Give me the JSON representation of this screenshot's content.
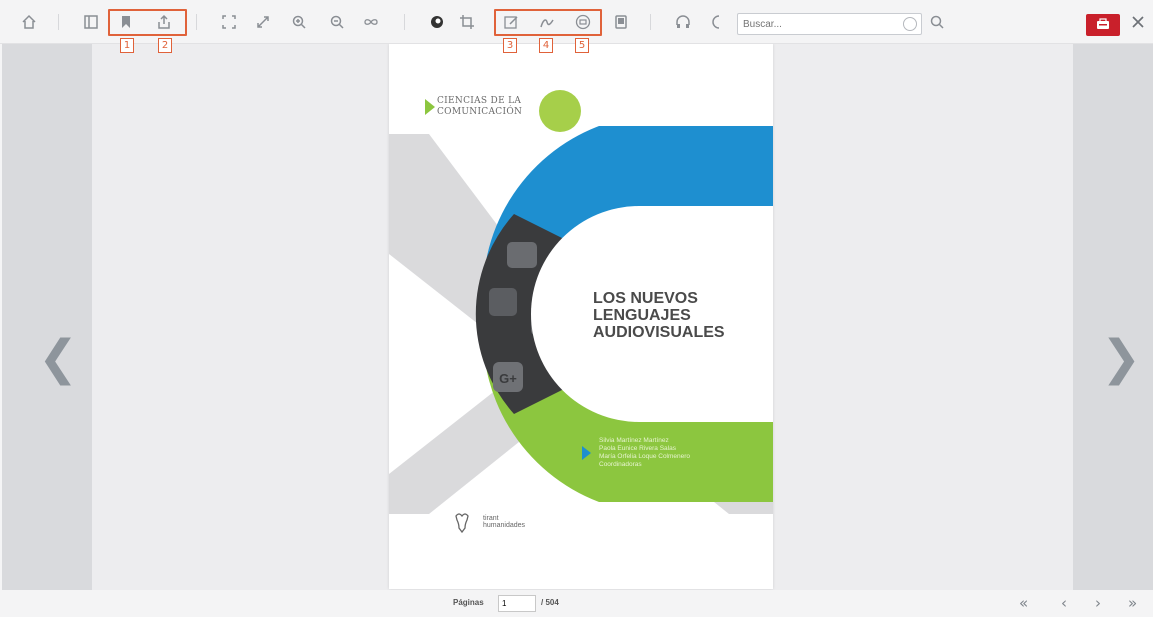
{
  "toolbar": {
    "search": {
      "placeholder": "Buscar...",
      "value": ""
    },
    "badges": [
      "1",
      "2",
      "3",
      "4",
      "5"
    ],
    "icons": [
      "home-icon",
      "sidebar-icon",
      "bookmark-icon",
      "share-icon",
      "fit-page-icon",
      "expand-icon",
      "zoom-in-icon",
      "zoom-out-icon",
      "infinity-icon",
      "hand-tool-icon",
      "crop-icon",
      "edit-icon",
      "signature-icon",
      "print-icon",
      "tablet-icon",
      "headphones-icon",
      "night-mode-icon",
      "search-icon",
      "cart-icon",
      "close-icon"
    ]
  },
  "book": {
    "series_line1": "CIENCIAS DE LA",
    "series_line2": "COMUNICACIÓN",
    "title_line1": "LOS NUEVOS",
    "title_line2": "LENGUAJES",
    "title_line3": "AUDIOVISUALES",
    "author1": "Silvia Martínez Martínez",
    "author2": "Paola Eunice Rivera Salas",
    "author3": "María Orfelia Loque Colmenero",
    "author_role": "Coordinadoras",
    "publisher_line1": "tirant",
    "publisher_line2": "humanidades"
  },
  "footer": {
    "page_label": "Páginas",
    "current_page": "1",
    "total_pages": "/ 504"
  },
  "colors": {
    "highlight": "#e0623a",
    "cart_button": "#c9202b",
    "cover_blue": "#1e8fd0",
    "cover_green": "#8cc63f"
  }
}
